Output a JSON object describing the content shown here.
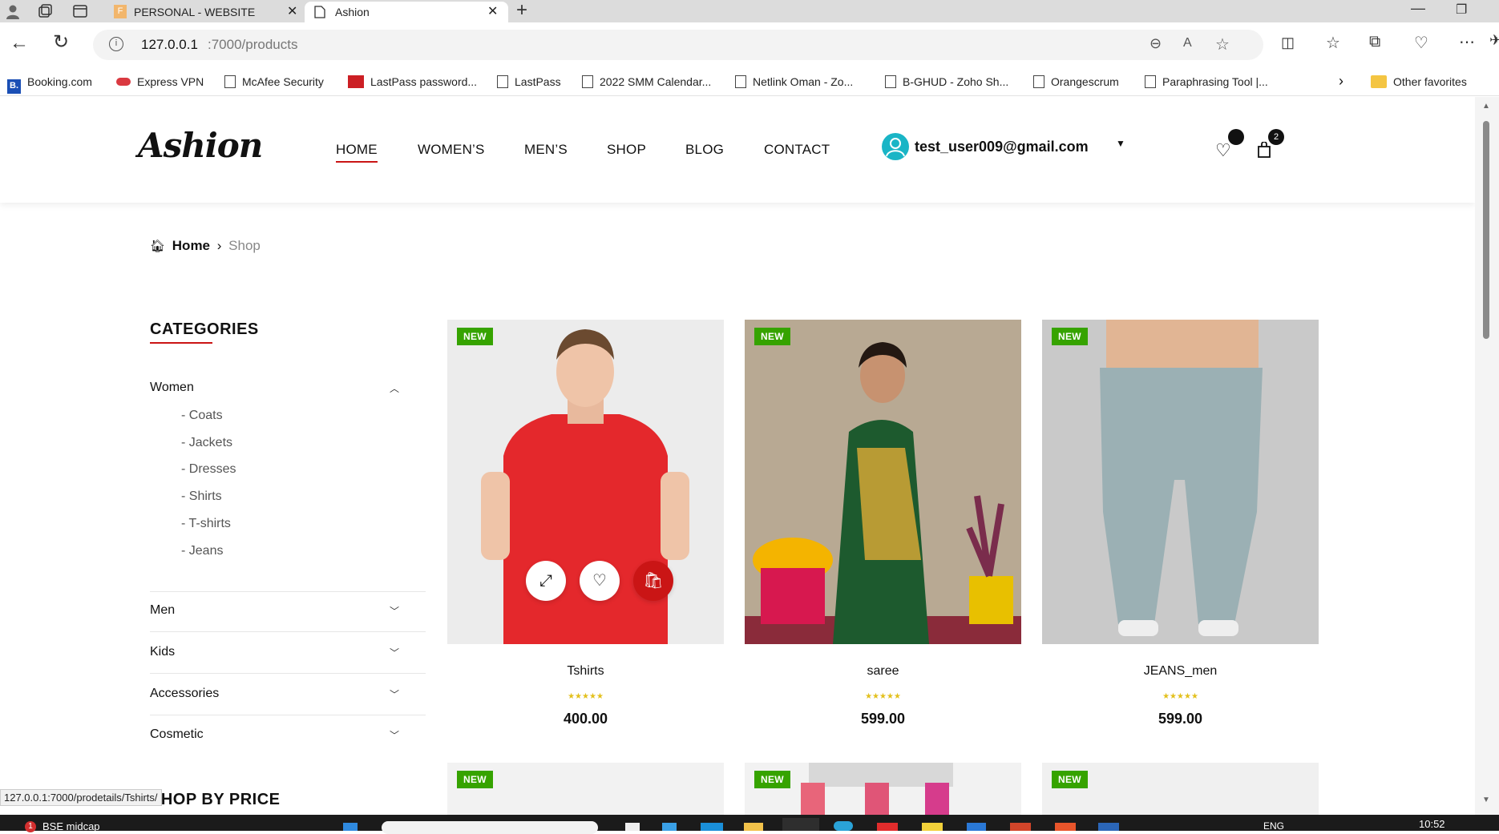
{
  "browser": {
    "tabs": [
      {
        "label": "PERSONAL - WEBSITE",
        "favicon": "F"
      },
      {
        "label": "Ashion"
      }
    ],
    "url_host": "127.0.0.1",
    "url_rest": ":7000/products",
    "bookmarks": [
      "Booking.com",
      "Express VPN",
      "McAfee Security",
      "LastPass password...",
      "LastPass",
      "2022 SMM Calendar...",
      "Netlink Oman - Zo...",
      "B-GHUD - Zoho Sh...",
      "Orangescrum",
      "Paraphrasing Tool |..."
    ],
    "other_favorites": "Other favorites",
    "status_url": "127.0.0.1:7000/prodetails/Tshirts/"
  },
  "site": {
    "logo": "Ashion",
    "nav": [
      "HOME",
      "WOMEN’S",
      "MEN’S",
      "SHOP",
      "BLOG",
      "CONTACT"
    ],
    "user_email": "test_user009@gmail.com",
    "cart_count": "2",
    "accent": "#ca1515"
  },
  "breadcrumb": {
    "home": "Home",
    "current": "Shop"
  },
  "sidebar": {
    "categories_title": "CATEGORIES",
    "women": "Women",
    "women_sub": [
      "Coats",
      "Jackets",
      "Dresses",
      "Shirts",
      "T-shirts",
      "Jeans"
    ],
    "others": [
      "Men",
      "Kids",
      "Accessories",
      "Cosmetic"
    ],
    "shop_by_price": "SHOP BY PRICE"
  },
  "products": [
    {
      "tag": "NEW",
      "name": "Tshirts",
      "stars": "★★★★★",
      "price": "400.00"
    },
    {
      "tag": "NEW",
      "name": "saree",
      "stars": "★★★★★",
      "price": "599.00"
    },
    {
      "tag": "NEW",
      "name": "JEANS_men",
      "stars": "★★★★★",
      "price": "599.00"
    }
  ],
  "products_row2_tags": [
    "NEW",
    "NEW",
    "NEW"
  ],
  "taskbar": {
    "notification": "1",
    "app": "BSE midcap",
    "lang": "ENG",
    "time": "10:52"
  }
}
